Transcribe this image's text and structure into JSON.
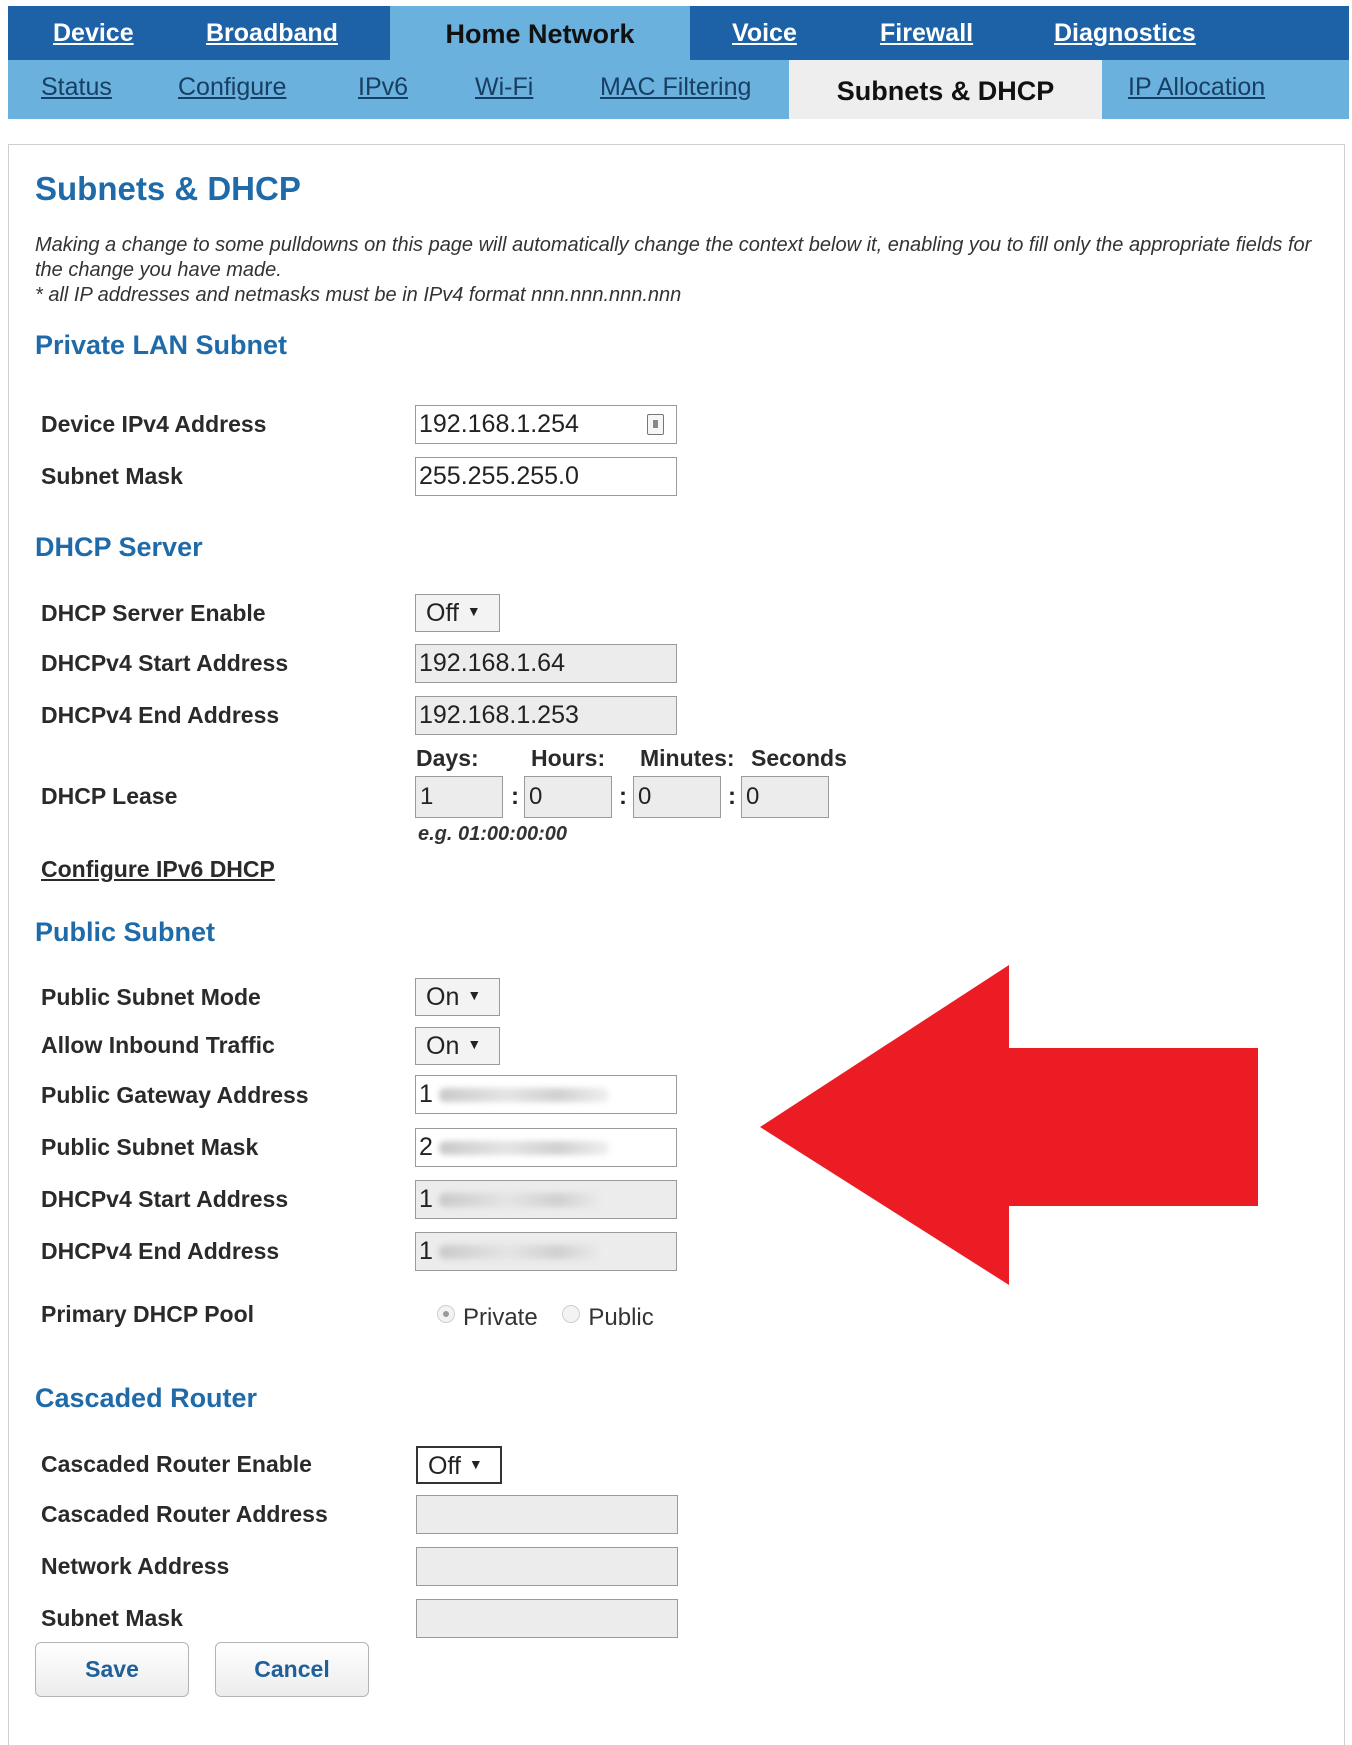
{
  "nav": {
    "main_tabs": [
      {
        "label": "Device"
      },
      {
        "label": "Broadband"
      },
      {
        "label": "Home Network"
      },
      {
        "label": "Voice"
      },
      {
        "label": "Firewall"
      },
      {
        "label": "Diagnostics"
      }
    ],
    "active_main": "Home Network",
    "sub_tabs": [
      {
        "label": "Status"
      },
      {
        "label": "Configure"
      },
      {
        "label": "IPv6"
      },
      {
        "label": "Wi-Fi"
      },
      {
        "label": "MAC Filtering"
      },
      {
        "label": "Subnets & DHCP"
      },
      {
        "label": "IP Allocation"
      }
    ],
    "active_sub": "Subnets & DHCP"
  },
  "page": {
    "title": "Subnets & DHCP",
    "intro_line1": "Making a change to some pulldowns on this page will automatically change the context below it, enabling you to fill only the appropriate fields for the change you have made.",
    "intro_line2": "* all IP addresses and netmasks must be in IPv4 format nnn.nnn.nnn.nnn"
  },
  "private_lan": {
    "section_title": "Private LAN Subnet",
    "device_ipv4_label": "Device IPv4 Address",
    "device_ipv4_value": "192.168.1.254",
    "subnet_mask_label": "Subnet Mask",
    "subnet_mask_value": "255.255.255.0"
  },
  "dhcp_server": {
    "section_title": "DHCP Server",
    "enable_label": "DHCP Server Enable",
    "enable_value": "Off",
    "start_label": "DHCPv4 Start Address",
    "start_value": "192.168.1.64",
    "end_label": "DHCPv4 End Address",
    "end_value": "192.168.1.253",
    "lease_label": "DHCP Lease",
    "lease_headers": {
      "days": "Days:",
      "hours": "Hours:",
      "minutes": "Minutes:",
      "seconds": "Seconds"
    },
    "lease_values": {
      "days": "1",
      "hours": "0",
      "minutes": "0",
      "seconds": "0"
    },
    "lease_colon": ":",
    "lease_example": "e.g. 01:00:00:00",
    "ipv6_link": "Configure IPv6 DHCP"
  },
  "public_subnet": {
    "section_title": "Public Subnet",
    "mode_label": "Public Subnet Mode",
    "mode_value": "On",
    "inbound_label": "Allow Inbound Traffic",
    "inbound_value": "On",
    "gateway_label": "Public Gateway Address",
    "gateway_value_prefix": "1",
    "mask_label": "Public Subnet Mask",
    "mask_value_prefix": "2",
    "start_label": "DHCPv4 Start Address",
    "start_value_prefix": "1",
    "end_label": "DHCPv4 End Address",
    "end_value_prefix": "1",
    "pool_label": "Primary DHCP Pool",
    "pool_options": [
      "Private",
      "Public"
    ],
    "pool_selected": "Private"
  },
  "cascaded_router": {
    "section_title": "Cascaded Router",
    "enable_label": "Cascaded Router Enable",
    "enable_value": "Off",
    "address_label": "Cascaded Router Address",
    "network_label": "Network Address",
    "mask_label": "Subnet Mask"
  },
  "buttons": {
    "save": "Save",
    "cancel": "Cancel"
  },
  "icons": {
    "select_caret": "▼",
    "key_icon": "key-icon",
    "annotation": "red-arrow-annotation"
  },
  "colors": {
    "nav_dark": "#1d62a6",
    "nav_light": "#6ab1de",
    "heading": "#1f6aa8",
    "arrow": "#ec1c24"
  }
}
